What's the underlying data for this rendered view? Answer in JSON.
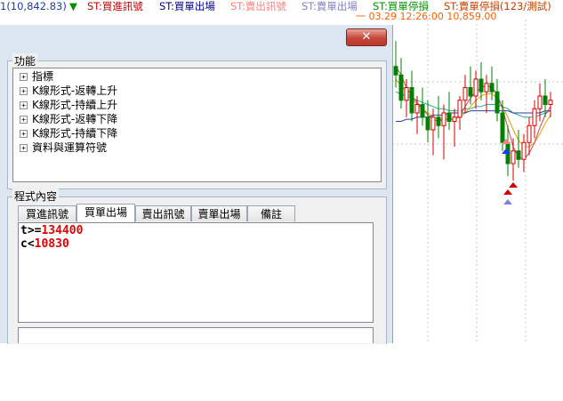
{
  "legend": {
    "price": "1(10,842.83)",
    "arrow": "▼",
    "items": [
      {
        "label": "ST:買進訊號",
        "color": "#c00000"
      },
      {
        "label": "ST:買單出場",
        "color": "#000080"
      },
      {
        "label": "ST:賣出訊號",
        "color": "#ff7f7f"
      },
      {
        "label": "ST:賣單出場",
        "color": "#8080c0"
      },
      {
        "label": "ST:買單停損",
        "color": "#009000"
      },
      {
        "label": "ST:賣單停損(123/測試)",
        "color": "#c04000"
      }
    ],
    "cursor_info": "一 03.29 12:26:00  10,859.00",
    "price_color": "#2040a0",
    "arrow_color": "#009000",
    "cursor_color": "#ff6000"
  },
  "dialog": {
    "close_glyph": "✕",
    "function_section": {
      "title": "功能",
      "items": [
        "指標",
        "K線形式-返轉上升",
        "K線形式-持續上升",
        "K線形式-返轉下降",
        "K線形式-持續下降",
        "資料與運算符號"
      ],
      "expander_glyph": "+"
    },
    "program_section": {
      "title": "程式內容",
      "tabs": [
        "買進訊號",
        "買單出場",
        "賣出訊號",
        "賣單出場",
        "備註"
      ],
      "active_tab": 1,
      "code": [
        {
          "var": "t",
          "op": ">=",
          "value": "134400"
        },
        {
          "var": "c",
          "op": "<",
          "value": "10830"
        }
      ]
    }
  },
  "chart_data": {
    "type": "candlestick",
    "title": "",
    "xlabel": "",
    "ylabel": "",
    "ylim": [
      10800,
      10880
    ],
    "candles": [
      {
        "o": 10862,
        "h": 10874,
        "l": 10852,
        "c": 10858
      },
      {
        "o": 10858,
        "h": 10866,
        "l": 10842,
        "c": 10846
      },
      {
        "o": 10846,
        "h": 10856,
        "l": 10838,
        "c": 10852
      },
      {
        "o": 10852,
        "h": 10860,
        "l": 10836,
        "c": 10840
      },
      {
        "o": 10840,
        "h": 10848,
        "l": 10830,
        "c": 10844
      },
      {
        "o": 10844,
        "h": 10852,
        "l": 10834,
        "c": 10838
      },
      {
        "o": 10838,
        "h": 10846,
        "l": 10826,
        "c": 10832
      },
      {
        "o": 10832,
        "h": 10842,
        "l": 10820,
        "c": 10838
      },
      {
        "o": 10838,
        "h": 10848,
        "l": 10828,
        "c": 10834
      },
      {
        "o": 10834,
        "h": 10844,
        "l": 10818,
        "c": 10840
      },
      {
        "o": 10840,
        "h": 10850,
        "l": 10832,
        "c": 10836
      },
      {
        "o": 10836,
        "h": 10842,
        "l": 10824,
        "c": 10838
      },
      {
        "o": 10838,
        "h": 10848,
        "l": 10832,
        "c": 10846
      },
      {
        "o": 10846,
        "h": 10858,
        "l": 10840,
        "c": 10852
      },
      {
        "o": 10852,
        "h": 10862,
        "l": 10844,
        "c": 10848
      },
      {
        "o": 10848,
        "h": 10860,
        "l": 10842,
        "c": 10856
      },
      {
        "o": 10856,
        "h": 10864,
        "l": 10846,
        "c": 10850
      },
      {
        "o": 10850,
        "h": 10858,
        "l": 10840,
        "c": 10854
      },
      {
        "o": 10854,
        "h": 10862,
        "l": 10846,
        "c": 10850
      },
      {
        "o": 10850,
        "h": 10856,
        "l": 10836,
        "c": 10840
      },
      {
        "o": 10840,
        "h": 10846,
        "l": 10822,
        "c": 10826
      },
      {
        "o": 10826,
        "h": 10834,
        "l": 10810,
        "c": 10816
      },
      {
        "o": 10816,
        "h": 10828,
        "l": 10808,
        "c": 10822
      },
      {
        "o": 10822,
        "h": 10832,
        "l": 10814,
        "c": 10818
      },
      {
        "o": 10818,
        "h": 10830,
        "l": 10812,
        "c": 10826
      },
      {
        "o": 10826,
        "h": 10838,
        "l": 10820,
        "c": 10834
      },
      {
        "o": 10834,
        "h": 10846,
        "l": 10828,
        "c": 10842
      },
      {
        "o": 10842,
        "h": 10854,
        "l": 10836,
        "c": 10848
      },
      {
        "o": 10848,
        "h": 10856,
        "l": 10838,
        "c": 10844
      },
      {
        "o": 10844,
        "h": 10850,
        "l": 10838,
        "c": 10846
      }
    ],
    "ma_series": [
      {
        "color": "#20b0a0",
        "values": [
          10850,
          10849,
          10848,
          10847,
          10846,
          10845,
          10844,
          10843,
          10842,
          10842,
          10841,
          10841,
          10841,
          10842,
          10842,
          10843,
          10843,
          10844,
          10844,
          10844,
          10843,
          10842,
          10840,
          10839,
          10838,
          10838,
          10838,
          10839,
          10840,
          10841
        ]
      },
      {
        "color": "#e0a000",
        "values": [
          10856,
          10853,
          10850,
          10847,
          10844,
          10842,
          10840,
          10838,
          10837,
          10837,
          10837,
          10837,
          10838,
          10840,
          10843,
          10846,
          10848,
          10849,
          10849,
          10847,
          10843,
          10838,
          10832,
          10827,
          10824,
          10824,
          10826,
          10830,
          10835,
          10839
        ]
      },
      {
        "color": "#3040a0",
        "values": [
          10836,
          10836,
          10837,
          10837,
          10838,
          10838,
          10838,
          10839,
          10839,
          10839,
          10840,
          10840,
          10840,
          10840,
          10841,
          10841,
          10841,
          10841,
          10841,
          10841,
          10841,
          10841,
          10840,
          10840,
          10840,
          10840,
          10840,
          10840,
          10841,
          10841
        ]
      },
      {
        "color": "#d04060",
        "values": [
          10862,
          10858,
          10852,
          10848,
          10845,
          10842,
          10839,
          10837,
          10836,
          10837,
          10837,
          10837,
          10839,
          10843,
          10847,
          10850,
          10852,
          10853,
          10852,
          10849,
          10842,
          10833,
          10824,
          10819,
          10818,
          10821,
          10826,
          10833,
          10839,
          10843
        ]
      }
    ]
  }
}
